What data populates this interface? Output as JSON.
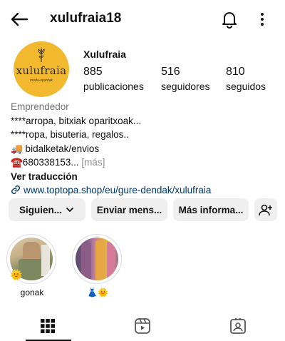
{
  "header": {
    "username": "xulufraia18",
    "icons": [
      "back-arrow-icon",
      "bell-icon",
      "more-vertical-icon"
    ]
  },
  "profile": {
    "avatar_logo": "xulufraia",
    "avatar_logo_sub": "moda-oparitak",
    "display_name": "Xulufraia",
    "stats": [
      {
        "value": "885",
        "label": "publicaciones"
      },
      {
        "value": "516",
        "label": "seguidores"
      },
      {
        "value": "810",
        "label": "seguidos"
      }
    ]
  },
  "bio": {
    "category": "Emprendedor",
    "line1": "****arropa, bitxiak oparitxoak...",
    "line2": "****ropa, bisuteria, regalos..",
    "line3": "🚚 bidalketak/envios",
    "line4": "☎️680338153...",
    "more": "[más]",
    "translate": "Ver traducción",
    "link": "www.toptopa.shop/eu/gure-dendak/xulufraia"
  },
  "actions": {
    "following": "Siguien...",
    "message": "Enviar mens...",
    "more_info": "Más informa..."
  },
  "highlights": [
    {
      "label": "gonak"
    },
    {
      "label": "👗🌞"
    }
  ],
  "tabs": [
    "grid-icon",
    "reels-icon",
    "tagged-icon"
  ],
  "colors": {
    "avatar_bg": "#f2b92f",
    "link": "#00376b",
    "button_bg": "#efefef",
    "muted": "#737373"
  }
}
